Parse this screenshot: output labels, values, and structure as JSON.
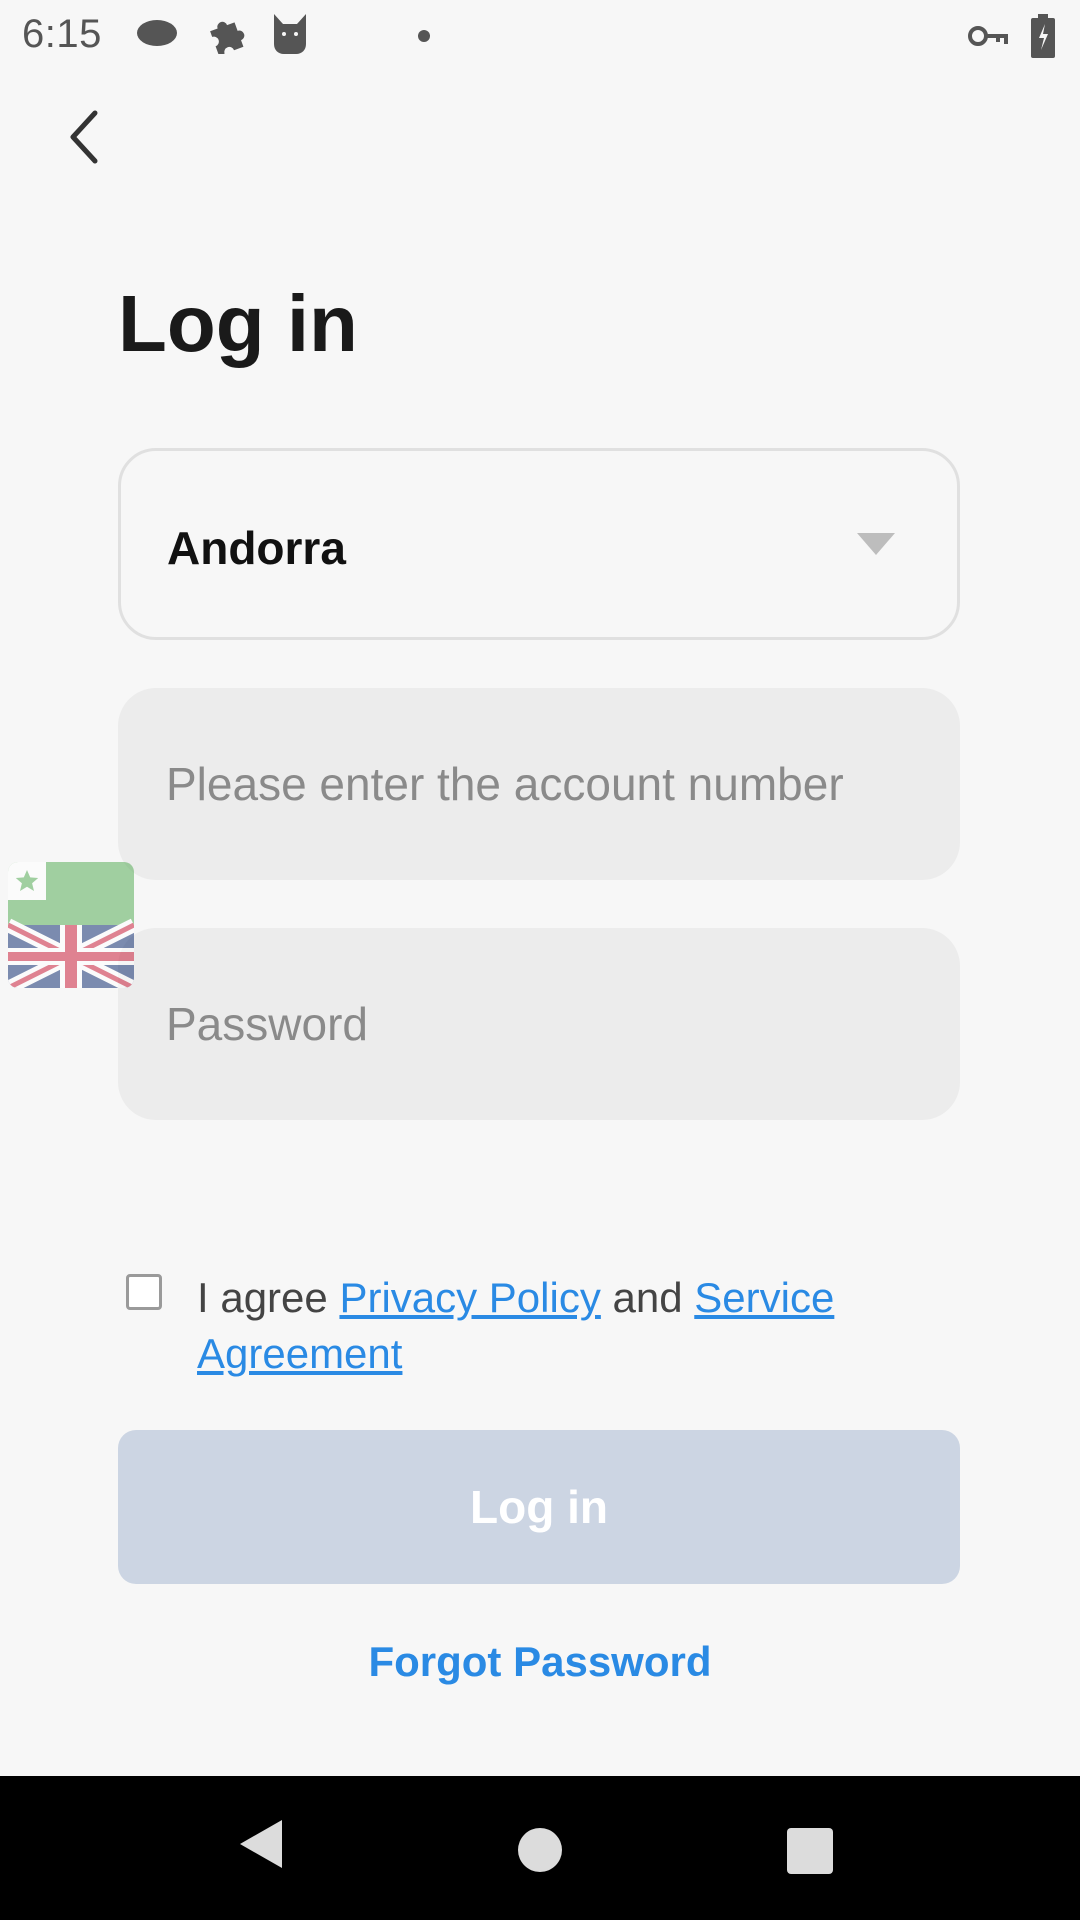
{
  "status_bar": {
    "time": "6:15",
    "icons": [
      "cloud-icon",
      "puzzle-icon",
      "cat-icon",
      "dot-icon",
      "vpn-key-icon",
      "battery-charging-icon"
    ]
  },
  "header": {
    "back_icon": "chevron-left-icon"
  },
  "page": {
    "title": "Log in"
  },
  "form": {
    "country": {
      "value": "Andorra",
      "icon": "dropdown-triangle-icon"
    },
    "account": {
      "placeholder": "Please enter the account number",
      "value": ""
    },
    "password": {
      "placeholder": "Password",
      "value": ""
    },
    "agreement": {
      "checked": false,
      "prefix": "I agree ",
      "privacy_link": "Privacy Policy",
      "conjunction": " and ",
      "service_link": "Service Agreement"
    },
    "login_button": "Log in",
    "forgot_password": "Forgot Password"
  },
  "language_widget": {
    "icon": "language-flag-icon"
  },
  "nav_bar": {
    "icons": [
      "nav-back-icon",
      "nav-home-icon",
      "nav-recents-icon"
    ]
  },
  "colors": {
    "accent": "#2a8ae4",
    "button_disabled": "#ccd5e3",
    "field_bg": "#ececec",
    "background": "#f7f7f7"
  }
}
